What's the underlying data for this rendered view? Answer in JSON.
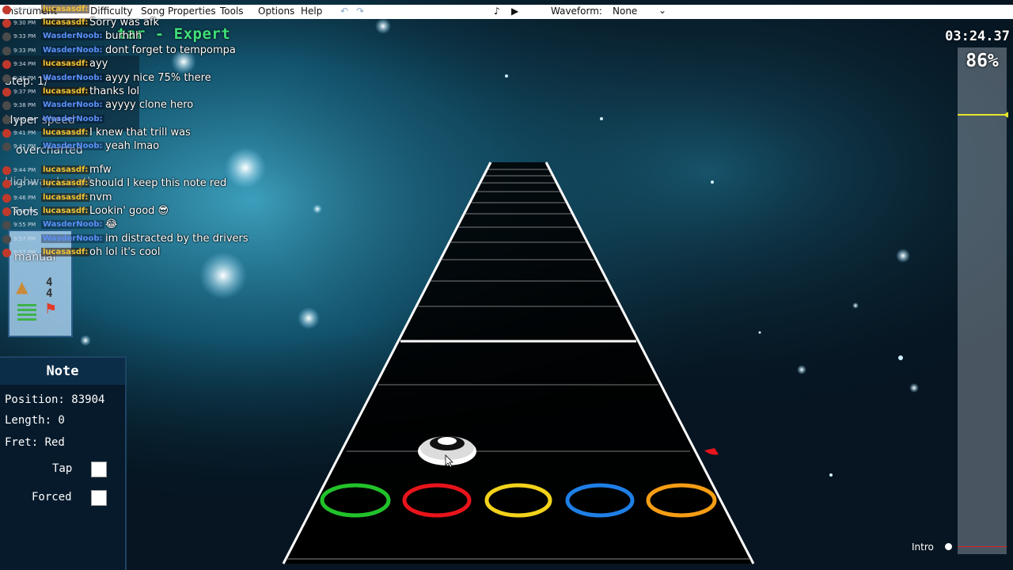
{
  "menu": {
    "items": [
      "Instrument",
      "Difficulty",
      "Song Properties",
      "Tools",
      "Options",
      "Help"
    ],
    "waveform_label": "Waveform:",
    "waveform_value": "None"
  },
  "editor": {
    "title_fragment": "tar - Expert",
    "ghost_labels": {
      "step": "Step: 1/",
      "hyperspeed": "Hyper speed",
      "song_name": "overcharted",
      "highway": "Highway Length",
      "tools": "Tools",
      "manual": "manual"
    },
    "time_signature": [
      "4",
      "4"
    ]
  },
  "chat": [
    {
      "time": "9:46 PM",
      "user": "lucasasdf:",
      "msg": ""
    },
    {
      "time": "9:30 PM",
      "user": "lucasasdf:",
      "msg": "Sorry was afk"
    },
    {
      "time": "9:33 PM",
      "user": "WasderNoob:",
      "msg": "burhhh"
    },
    {
      "time": "9:33 PM",
      "user": "WasderNoob:",
      "msg": "dont forget to tempompa"
    },
    {
      "time": "9:34 PM",
      "user": "lucasasdf:",
      "msg": "ayy"
    },
    {
      "time": "9:36 PM",
      "user": "WasderNoob:",
      "msg": "ayyy nice 75% there"
    },
    {
      "time": "9:37 PM",
      "user": "lucasasdf:",
      "msg": "thanks lol"
    },
    {
      "time": "9:38 PM",
      "user": "WasderNoob:",
      "msg": "ayyyy clone hero"
    },
    {
      "time": "9:40 PM",
      "user": "WasderNoob:",
      "msg": ""
    },
    {
      "time": "9:41 PM",
      "user": "lucasasdf:",
      "msg": "I knew that trill was"
    },
    {
      "time": "9:42 PM",
      "user": "WasderNoob:",
      "msg": "yeah lmao"
    },
    {
      "time": "9:44 PM",
      "user": "lucasasdf:",
      "msg": "mfw"
    },
    {
      "time": "9:45 PM",
      "user": "lucasasdf:",
      "msg": "should I keep this note red"
    },
    {
      "time": "9:46 PM",
      "user": "lucasasdf:",
      "msg": "nvm"
    },
    {
      "time": "9:48 PM",
      "user": "lucasasdf:",
      "msg": "Lookin' good 😎"
    },
    {
      "time": "9:55 PM",
      "user": "WasderNoob:",
      "msg": "😂"
    },
    {
      "time": "9:57 PM",
      "user": "WasderNoob:",
      "msg": "im distracted by the drivers"
    },
    {
      "time": "9:57 PM",
      "user": "lucasasdf:",
      "msg": "oh lol it's cool"
    }
  ],
  "note_panel": {
    "title": "Note",
    "position": "Position: 83904",
    "length": "Length: 0",
    "fret": "Fret: Red",
    "tap_label": "Tap",
    "forced_label": "Forced"
  },
  "status": {
    "timer": "03:24.37",
    "percent": "86%",
    "section": "Intro"
  },
  "colors": {
    "green": "#22c22a",
    "red": "#e8141b",
    "yellow": "#f2d21b",
    "blue": "#1e7fe6",
    "orange": "#f59d14",
    "progress_marker": "#e6e62a"
  }
}
